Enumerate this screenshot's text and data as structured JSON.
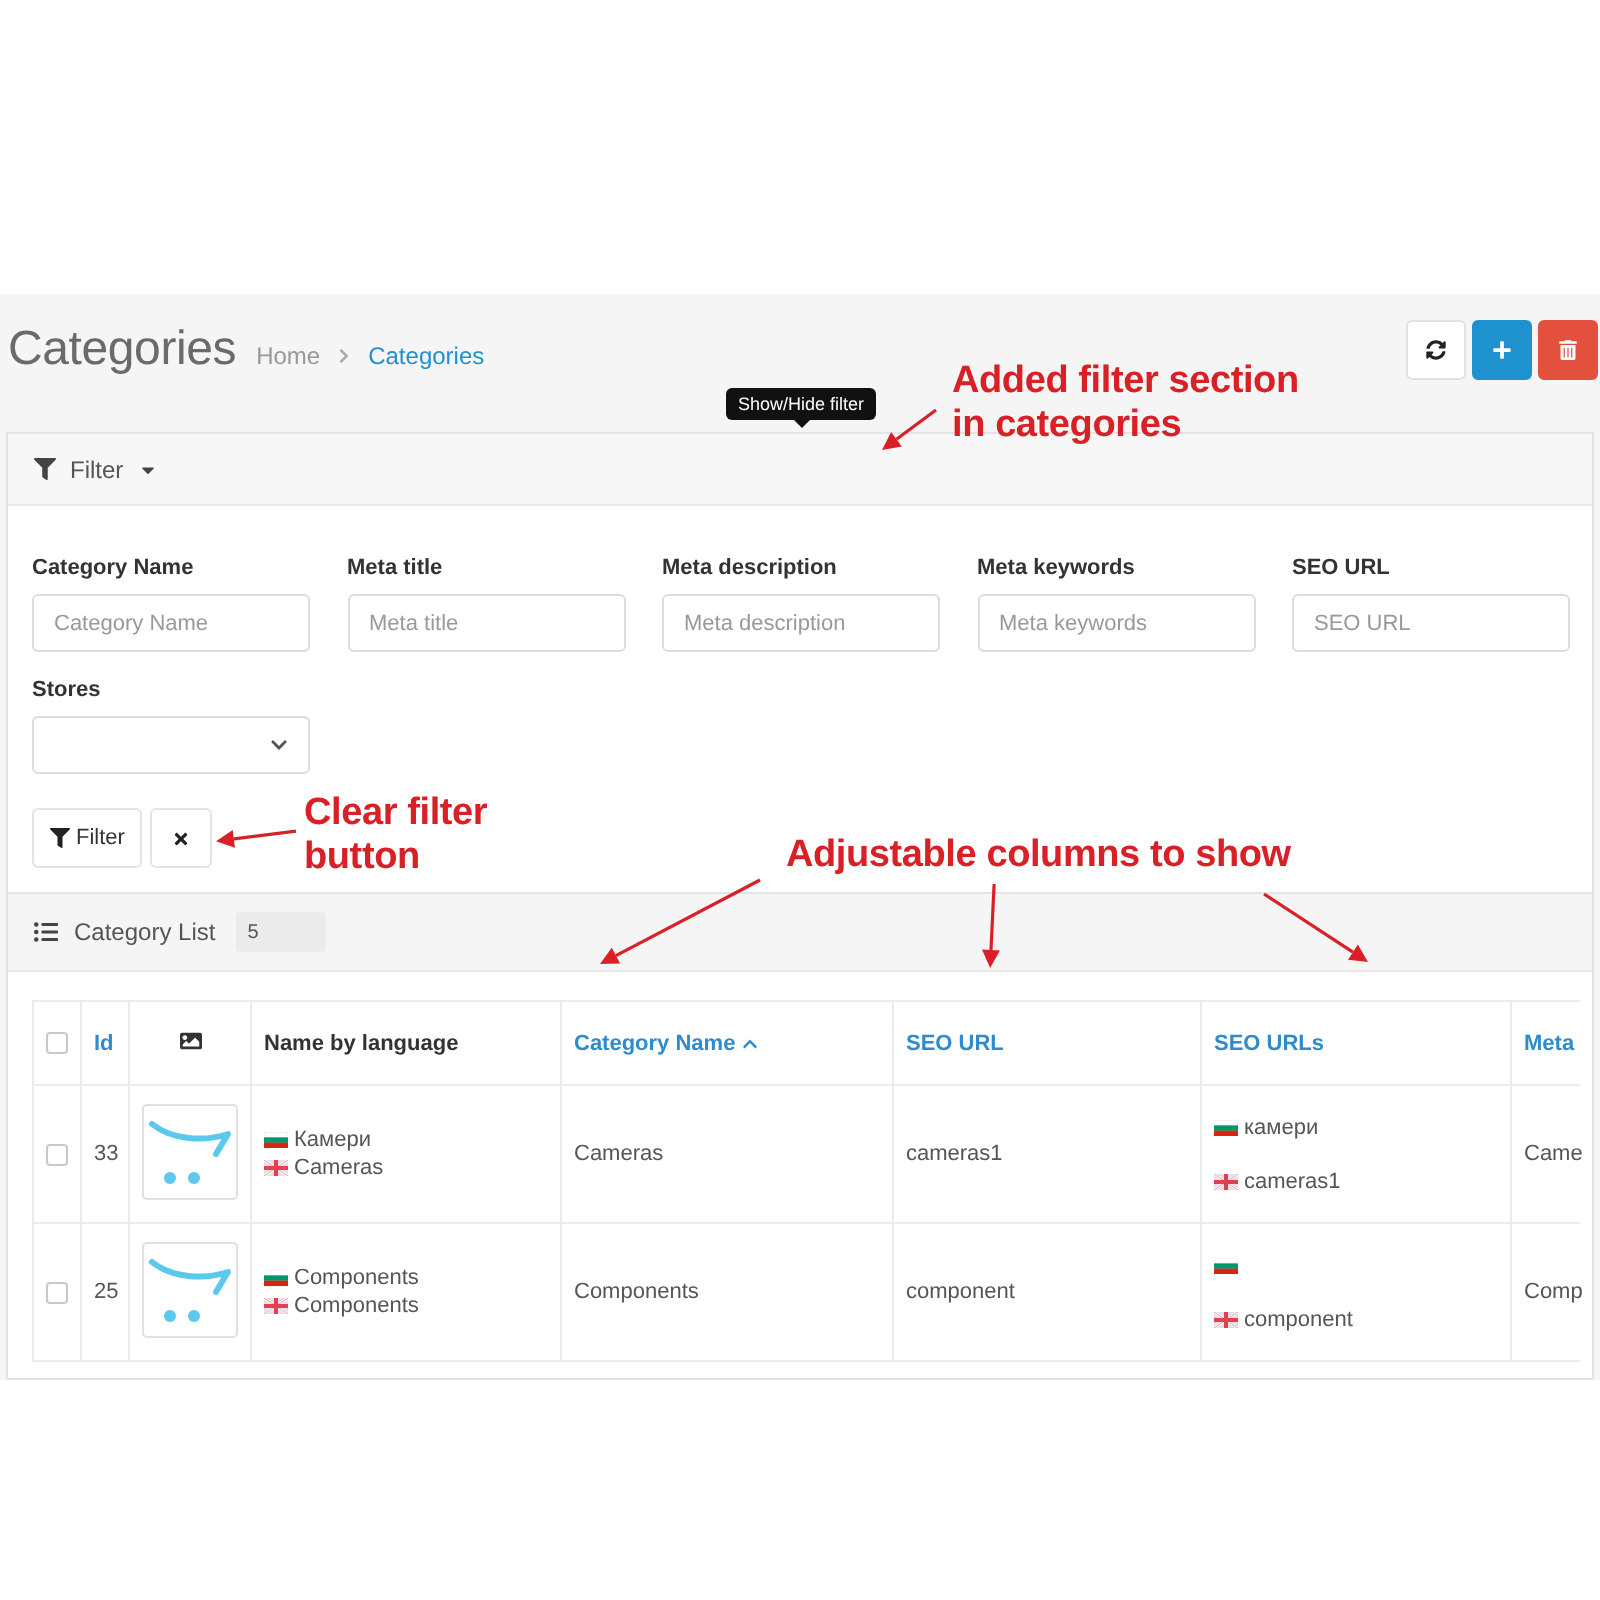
{
  "header": {
    "title": "Categories",
    "breadcrumb": [
      {
        "label": "Home",
        "active": false
      },
      {
        "label": "Categories",
        "active": true
      }
    ],
    "actions": [
      {
        "kind": "refresh"
      },
      {
        "kind": "add"
      },
      {
        "kind": "delete"
      }
    ]
  },
  "tooltip": {
    "text": "Show/Hide filter"
  },
  "filter": {
    "title": "Filter",
    "fields": [
      {
        "kind": "text",
        "label": "Category Name",
        "placeholder": "Category Name"
      },
      {
        "kind": "text",
        "label": "Meta title",
        "placeholder": "Meta title"
      },
      {
        "kind": "text",
        "label": "Meta description",
        "placeholder": "Meta description"
      },
      {
        "kind": "text",
        "label": "Meta keywords",
        "placeholder": "Meta keywords"
      },
      {
        "kind": "text",
        "label": "SEO URL",
        "placeholder": "SEO URL"
      },
      {
        "kind": "select",
        "label": "Stores"
      }
    ],
    "buttons": [
      {
        "kind": "apply",
        "label": "Filter"
      },
      {
        "kind": "clear"
      }
    ]
  },
  "category_list": {
    "title": "Category List",
    "count": "5"
  },
  "table": {
    "columns": [
      {
        "kind": "checkbox",
        "checked": false
      },
      {
        "kind": "text",
        "label": "Id",
        "sortable": true,
        "sorted": false
      },
      {
        "kind": "image"
      },
      {
        "kind": "text",
        "label": "Name by language",
        "sortable": false,
        "sorted": false
      },
      {
        "kind": "text",
        "label": "Category Name",
        "sortable": true,
        "sorted": true
      },
      {
        "kind": "text",
        "label": "SEO URL",
        "sortable": true,
        "sorted": false
      },
      {
        "kind": "text",
        "label": "SEO URLs",
        "sortable": true,
        "sorted": false
      },
      {
        "kind": "text",
        "label": "Meta",
        "sortable": true,
        "sorted": false
      }
    ],
    "rows": [
      {
        "selected": false,
        "id": "33",
        "names": [
          {
            "kind": "bg",
            "text": "Камери"
          },
          {
            "kind": "en",
            "text": "Cameras"
          }
        ],
        "category_name": "Cameras",
        "seo_url": "cameras1",
        "seo_urls": [
          {
            "kind": "bg",
            "text": "камери"
          },
          {
            "kind": "en",
            "text": "cameras1"
          }
        ],
        "meta": "Came"
      },
      {
        "selected": false,
        "id": "25",
        "names": [
          {
            "kind": "bg",
            "text": "Components"
          },
          {
            "kind": "en",
            "text": "Components"
          }
        ],
        "category_name": "Components",
        "seo_url": "component",
        "seo_urls": [
          {
            "kind": "bg"
          },
          {
            "kind": "en",
            "text": "component"
          }
        ],
        "meta": "Comp"
      }
    ]
  },
  "annotations": [
    {
      "text": "Added filter section\nin categories"
    },
    {
      "text": "Clear filter\nbutton"
    },
    {
      "text": "Adjustable columns to show"
    }
  ]
}
